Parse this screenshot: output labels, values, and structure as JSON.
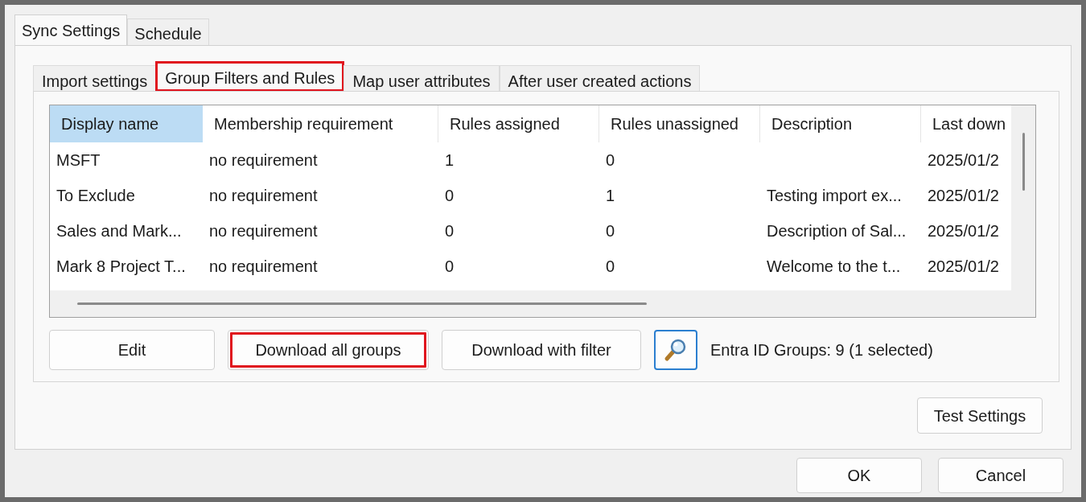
{
  "top_tabs": [
    {
      "label": "Sync Settings",
      "selected": true
    },
    {
      "label": "Schedule",
      "selected": false
    }
  ],
  "sub_tabs": [
    {
      "label": "Import settings",
      "selected": false,
      "highlighted": false
    },
    {
      "label": "Group Filters and Rules",
      "selected": true,
      "highlighted": true
    },
    {
      "label": "Map user attributes",
      "selected": false,
      "highlighted": false
    },
    {
      "label": "After user created actions",
      "selected": false,
      "highlighted": false
    }
  ],
  "table": {
    "columns": [
      {
        "label": "Display name",
        "selected": true
      },
      {
        "label": "Membership requirement",
        "selected": false
      },
      {
        "label": "Rules assigned",
        "selected": false
      },
      {
        "label": "Rules unassigned",
        "selected": false
      },
      {
        "label": "Description",
        "selected": false
      },
      {
        "label": "Last down",
        "selected": false
      }
    ],
    "rows": [
      [
        "MSFT",
        "no requirement",
        "1",
        "0",
        "",
        "2025/01/2"
      ],
      [
        "To Exclude",
        "no requirement",
        "0",
        "1",
        "Testing import ex...",
        "2025/01/2"
      ],
      [
        "Sales and Mark...",
        "no requirement",
        "0",
        "0",
        "Description of Sal...",
        "2025/01/2"
      ],
      [
        "Mark 8 Project T...",
        "no requirement",
        "0",
        "0",
        "Welcome to the t...",
        "2025/01/2"
      ]
    ]
  },
  "actions": [
    {
      "label": "Edit",
      "highlighted": false
    },
    {
      "label": "Download all groups",
      "highlighted": true
    },
    {
      "label": "Download with filter",
      "highlighted": false
    }
  ],
  "group_count": "Entra ID Groups: 9 (1 selected)",
  "test_button": "Test Settings",
  "dialog_buttons": [
    "OK",
    "Cancel"
  ]
}
